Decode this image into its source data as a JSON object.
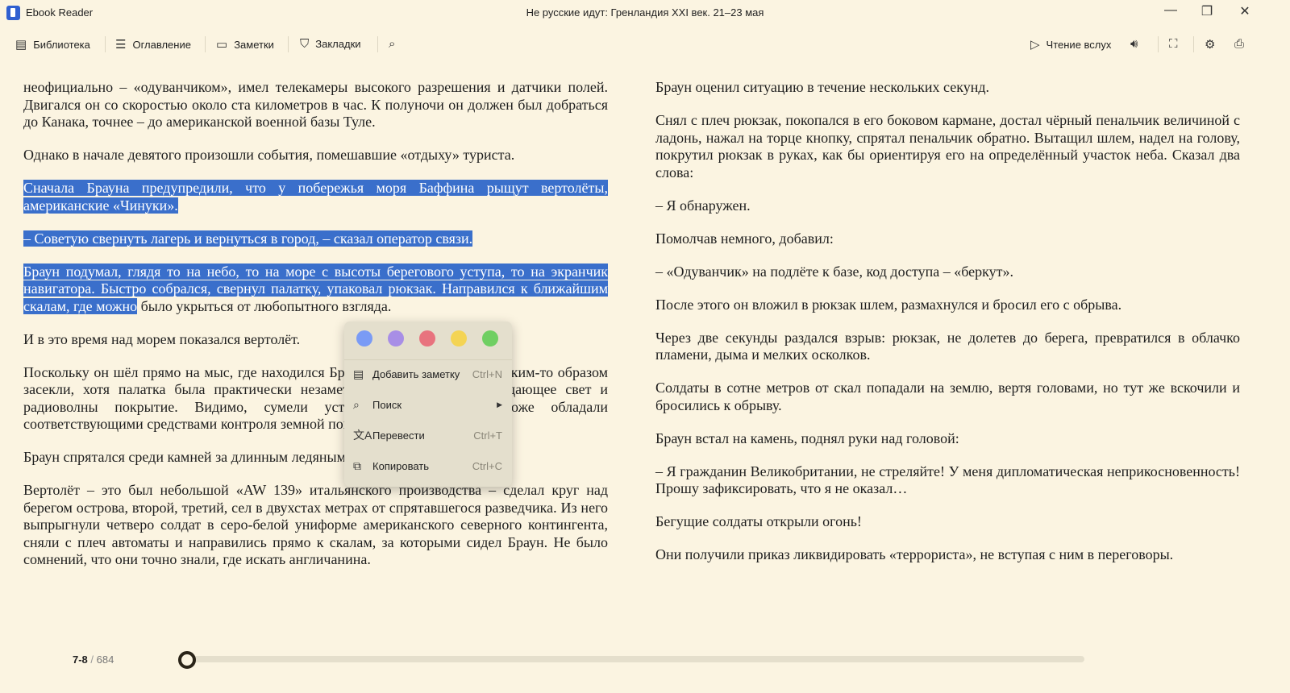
{
  "app": {
    "name": "Ebook Reader",
    "title": "Не русские идут: Гренландия XXI век. 21–23 мая",
    "window_buttons": [
      "minimize",
      "maximize",
      "close"
    ]
  },
  "toolbar": {
    "library": "Библиотека",
    "contents": "Оглавление",
    "notes": "Заметки",
    "bookmarks": "Закладки",
    "read_aloud": "Чтение вслух"
  },
  "left_column": [
    "неофициально – «одуванчиком», имел телекамеры высокого разрешения и датчики полей. Двигался он со скоростью около ста километров в час. К полуночи он должен был добраться до Канака, точнее – до американской военной базы Туле.",
    "Однако в начале девятого произошли события, помешавшие «отдыху» туриста.",
    "Сначала Брауна предупредили, что у побережья моря Баффина рыщут вертолёты, американские «Чинуки».",
    "– Советую свернуть лагерь и вернуться в город, – сказал оператор связи.",
    "И в это время над морем показался вертолёт.",
    "Поскольку он шёл прямо на мыс, где находился Браун, стало ясно, что его каким-то образом засекли, хотя палатка была практически незаметна, имея особое, поглощающее свет и радиоволны покрытие. Видимо, сумели установить наблюдение, тоже обладали соответствующими средствами контроля земной поверхности.",
    "Браун спрятался среди камней за длинным ледяным торосом.",
    "Вертолёт – это был небольшой «AW 139» итальянского производства – сделал круг над берегом острова, второй, третий, сел в двухстах метрах от спрятавшегося разведчика. Из него выпрыгнули четверо солдат в серо-белой униформе американского северного контингента, сняли с плеч автоматы и направились прямо к скалам, за которыми сидел Браун. Не было сомнений, что они точно знали, где искать англичанина."
  ],
  "selected_paragraph": {
    "selected": "Браун подумал, глядя то на небо, то на море с высоты берегового уступа, то на экранчик навигатора. Быстро собрался, свернул палатку, упаковал рюкзак. Направился к ближайшим скалам, где можно",
    "rest": " было укрыться от любопытного взгляда."
  },
  "right_column": [
    "Браун оценил ситуацию в течение нескольких секунд.",
    "Снял с плеч рюкзак, покопался в его боковом кармане, достал чёрный пенальчик величиной с ладонь, нажал на торце кнопку, спрятал пенальчик обратно. Вытащил шлем, надел на голову, покрутил рюкзак в руках, как бы ориентируя его на определённый участок неба. Сказал два слова:",
    "– Я обнаружен.",
    "Помолчав немного, добавил:",
    "– «Одуванчик» на подлёте к базе, код доступа – «беркут».",
    "После этого он вложил в рюкзак шлем, размахнулся и бросил его с обрыва.",
    "Через две секунды раздался взрыв: рюкзак, не долетев до берега, превратился в облачко пламени, дыма и мелких осколков.",
    "Солдаты в сотне метров от скал попадали на землю, вертя головами, но тут же вскочили и бросились к обрыву.",
    "Браун встал на камень, поднял руки над головой:",
    "– Я гражданин Великобритании, не стреляйте! У меня дипломатическая неприкосновенность! Прошу зафиксировать, что я не оказал…",
    "Бегущие солдаты открыли огонь!",
    "Они получили приказ ликвидировать «террориста», не вступая с ним в переговоры."
  ],
  "context_menu": {
    "highlight_colors": [
      "#7a9bf5",
      "#a88ee6",
      "#e8737e",
      "#f4d454",
      "#6fcf62"
    ],
    "items": [
      {
        "label": "Добавить заметку",
        "shortcut": "Ctrl+N",
        "icon": "note-icon"
      },
      {
        "label": "Поиск",
        "shortcut": "",
        "icon": "search-icon",
        "submenu": true
      },
      {
        "label": "Перевести",
        "shortcut": "Ctrl+T",
        "icon": "translate-icon"
      },
      {
        "label": "Копировать",
        "shortcut": "Ctrl+C",
        "icon": "copy-icon"
      }
    ]
  },
  "footer": {
    "current_pages": "7-8",
    "separator": "/",
    "total_pages": "684",
    "progress": 0
  }
}
